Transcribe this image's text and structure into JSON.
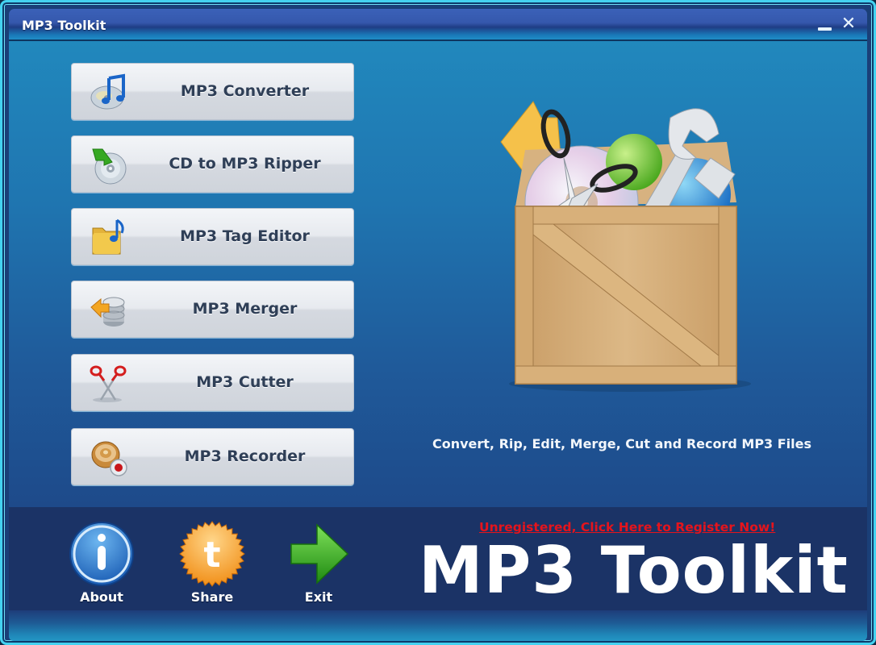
{
  "window": {
    "title": "MP3 Toolkit",
    "controls": {
      "minimize": "minimize",
      "close": "✕"
    }
  },
  "features": [
    {
      "id": "converter",
      "label": "MP3 Converter",
      "icon": "music-cd-icon"
    },
    {
      "id": "ripper",
      "label": "CD to MP3 Ripper",
      "icon": "cd-rip-icon"
    },
    {
      "id": "tag-editor",
      "label": "MP3 Tag Editor",
      "icon": "music-folder-icon"
    },
    {
      "id": "merger",
      "label": "MP3 Merger",
      "icon": "merge-stack-icon"
    },
    {
      "id": "cutter",
      "label": "MP3 Cutter",
      "icon": "scissors-icon"
    },
    {
      "id": "recorder",
      "label": "MP3 Recorder",
      "icon": "speaker-record-icon"
    }
  ],
  "hero": {
    "illustration": "toolbox-crate-illustration",
    "tagline": "Convert, Rip, Edit, Merge, Cut and Record MP3 Files"
  },
  "footer": {
    "actions": [
      {
        "id": "about",
        "label": "About",
        "icon": "info-icon"
      },
      {
        "id": "share",
        "label": "Share",
        "icon": "share-badge-icon"
      },
      {
        "id": "exit",
        "label": "Exit",
        "icon": "exit-arrow-icon"
      }
    ],
    "register_link": "Unregistered, Click Here to Register Now!",
    "brand": "MP3 Toolkit"
  },
  "colors": {
    "accent_frame": "#44d2f0",
    "content_bg": "#1f75b0",
    "footer_bg": "#1b3366",
    "button_text": "#2f3f57",
    "register_red": "#e5141c"
  }
}
